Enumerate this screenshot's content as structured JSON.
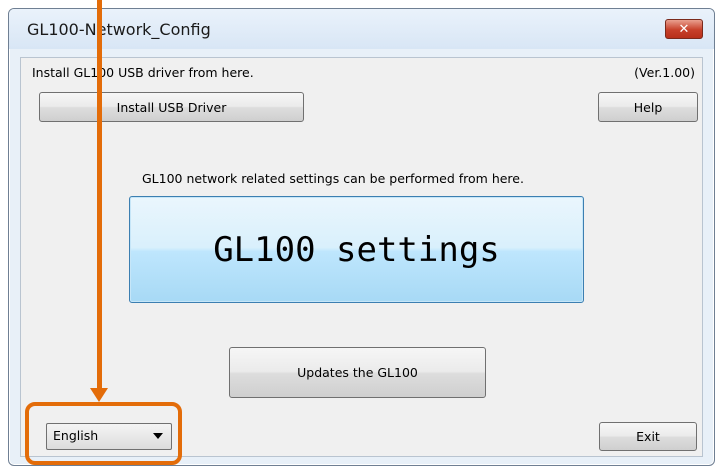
{
  "window": {
    "title": "GL100-Network_Config",
    "close_glyph": "✕"
  },
  "header": {
    "install_hint": "Install GL100 USB driver from here.",
    "version": "(Ver.1.00)"
  },
  "buttons": {
    "install_usb_driver": "Install USB Driver",
    "help": "Help",
    "gl100_settings": "GL100 settings",
    "updates": "Updates the GL100",
    "exit": "Exit"
  },
  "settings_hint": "GL100 network related settings can be performed from here.",
  "language_select": {
    "selected": "English",
    "icon": "chevron-down-icon"
  },
  "annotation": {
    "color": "#e36c09"
  }
}
